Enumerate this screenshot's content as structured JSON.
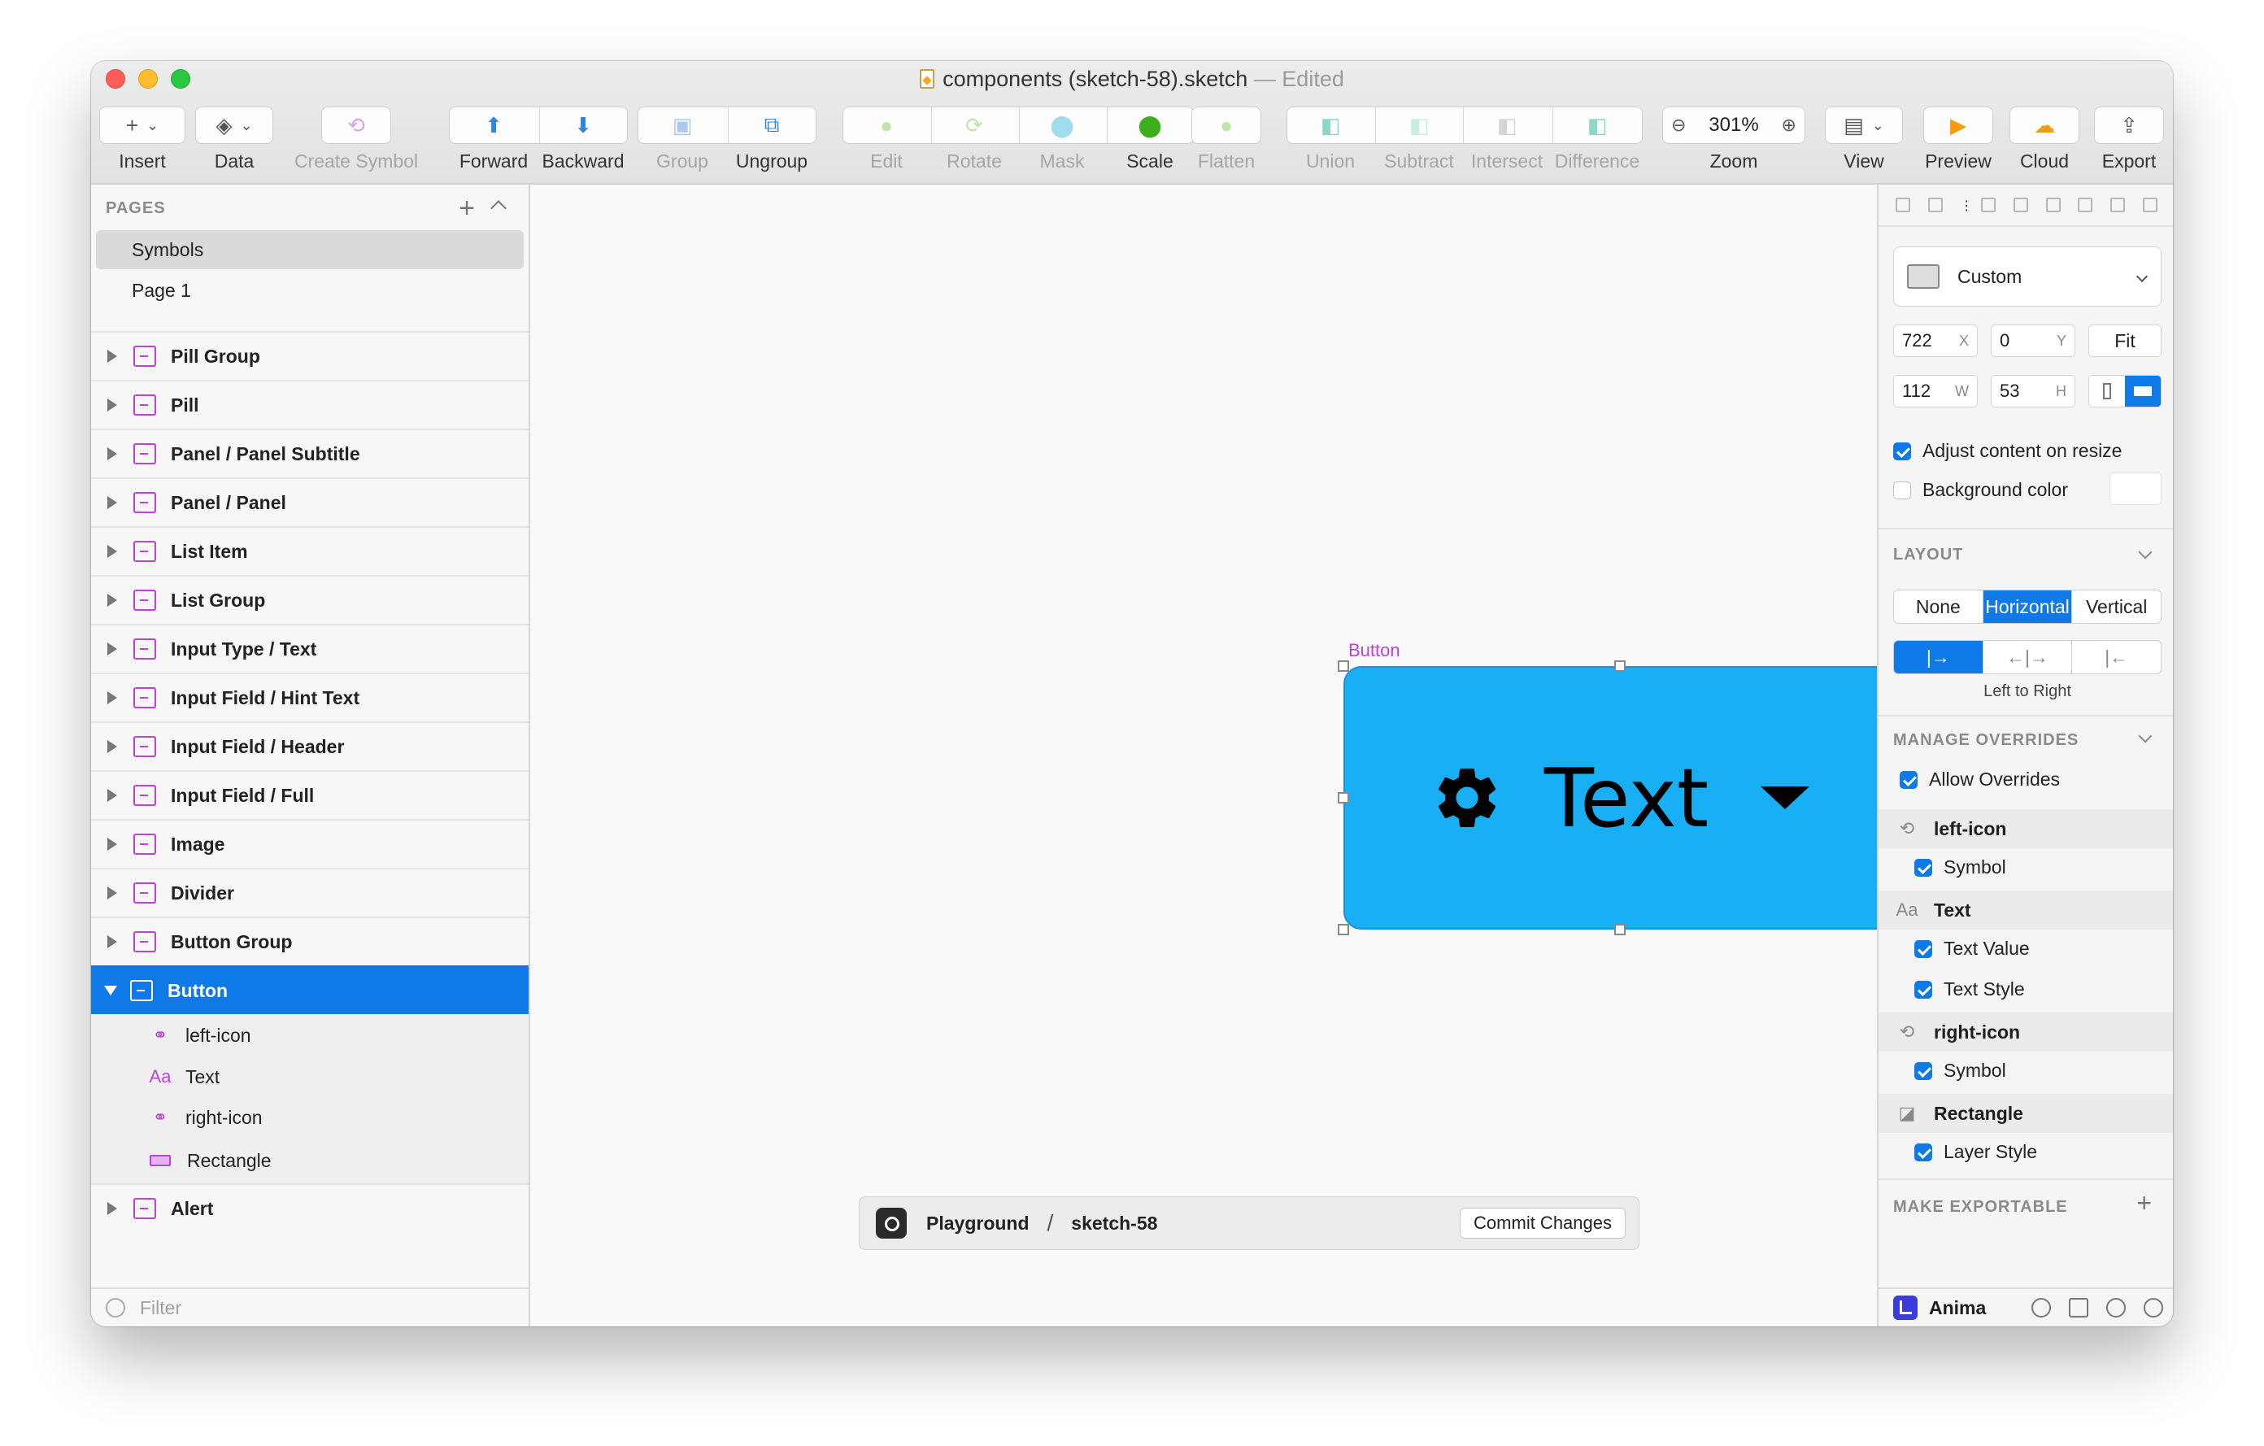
{
  "window": {
    "title": "components (sketch-58).sketch",
    "title_suffix": " — Edited"
  },
  "toolbar": {
    "insert": "Insert",
    "data": "Data",
    "create_symbol": "Create Symbol",
    "forward": "Forward",
    "backward": "Backward",
    "group": "Group",
    "ungroup": "Ungroup",
    "edit": "Edit",
    "rotate": "Rotate",
    "mask": "Mask",
    "scale": "Scale",
    "flatten": "Flatten",
    "union": "Union",
    "subtract": "Subtract",
    "intersect": "Intersect",
    "difference": "Difference",
    "zoom_value": "301%",
    "zoom": "Zoom",
    "view": "View",
    "preview": "Preview",
    "cloud": "Cloud",
    "export": "Export"
  },
  "sidebar": {
    "pages_header": "PAGES",
    "pages": [
      "Symbols",
      "Page 1"
    ],
    "layers": [
      "Pill Group",
      "Pill",
      "Panel / Panel Subtitle",
      "Panel / Panel",
      "List Item",
      "List Group",
      "Input Type / Text",
      "Input Field / Hint Text",
      "Input Field / Header",
      "Input Field / Full",
      "Image",
      "Divider",
      "Button Group",
      "Button"
    ],
    "children": [
      "left-icon",
      "Text",
      "right-icon",
      "Rectangle"
    ],
    "last_layer": "Alert",
    "filter_placeholder": "Filter"
  },
  "canvas": {
    "artboard_label": "Button",
    "button_text": "Text",
    "button_color": "#18aff4"
  },
  "playground": {
    "project": "Playground",
    "separator": "/",
    "branch": "sketch-58",
    "commit": "Commit Changes"
  },
  "inspector": {
    "preset": "Custom",
    "x": "722",
    "x_label": "X",
    "y": "0",
    "y_label": "Y",
    "w": "112",
    "w_label": "W",
    "h": "53",
    "h_label": "H",
    "fit": "Fit",
    "adjust_content": "Adjust content on resize",
    "background_color": "Background color",
    "layout_header": "LAYOUT",
    "layout_options": [
      "None",
      "Horizontal",
      "Vertical"
    ],
    "direction_label": "Left to Right",
    "overrides_header": "MANAGE OVERRIDES",
    "allow_overrides": "Allow Overrides",
    "override_groups": [
      {
        "name": "left-icon",
        "items": [
          "Symbol"
        ]
      },
      {
        "name": "Text",
        "items": [
          "Text Value",
          "Text Style"
        ]
      },
      {
        "name": "right-icon",
        "items": [
          "Symbol"
        ]
      },
      {
        "name": "Rectangle",
        "items": [
          "Layer Style"
        ]
      }
    ],
    "make_exportable": "MAKE EXPORTABLE",
    "plus": "+"
  },
  "anima": {
    "label": "Anima"
  },
  "icons": {
    "text_glyph": "Aa",
    "sync_glyph": "⟲"
  }
}
